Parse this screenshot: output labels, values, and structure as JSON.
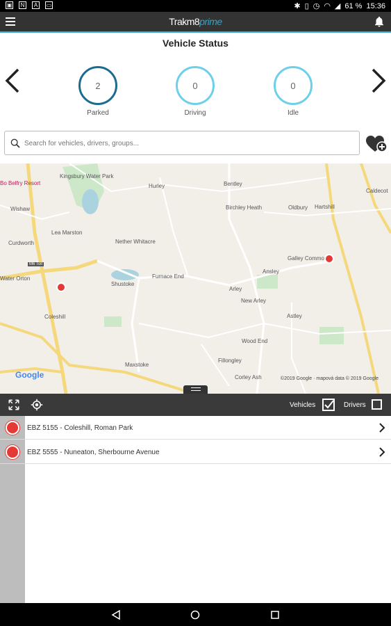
{
  "statusbar": {
    "left_icons": [
      "image-icon",
      "n-icon",
      "a-icon",
      "screen-icon"
    ],
    "right_icons": [
      "bluetooth-icon",
      "vibrate-icon",
      "alarm-icon",
      "wifi-icon",
      "signal-icon"
    ],
    "battery": "61 %",
    "time": "15:36"
  },
  "appbar": {
    "logo_main": "Trakm8",
    "logo_accent": "prime"
  },
  "vehicle_status": {
    "title": "Vehicle Status",
    "parked": {
      "count": "2",
      "label": "Parked"
    },
    "driving": {
      "count": "0",
      "label": "Driving"
    },
    "idle": {
      "count": "0",
      "label": "Idle"
    }
  },
  "search": {
    "placeholder": "Search for vehicles, drivers, groups..."
  },
  "map": {
    "labels": [
      "Kingsbury Water Park",
      "Hurley",
      "Bentley",
      "Caldecot",
      "Bo Belfry Resort",
      "Wishaw",
      "Birchley Heath",
      "Oldbury",
      "Hartshill",
      "Lea Marston",
      "Curdworth",
      "Nether Whitacre",
      "Galley Common",
      "Ansley",
      "M6 Toll",
      "Water Orton",
      "Shustoke",
      "Furnace End",
      "Arley",
      "New Arley",
      "Coleshill",
      "Astley",
      "Wood End",
      "Fillongley",
      "Maxstoke",
      "Corley Ash"
    ],
    "logo": "Google",
    "copyright": "©2019 Google · mapová data © 2019 Google"
  },
  "toolbar": {
    "vehicles_label": "Vehicles",
    "drivers_label": "Drivers",
    "vehicles_checked": true,
    "drivers_checked": false
  },
  "vehicles": [
    {
      "text": "EBZ 5155 - Coleshill, Roman Park"
    },
    {
      "text": "EBZ 5555 - Nuneaton, Sherbourne Avenue"
    }
  ],
  "colors": {
    "accent": "#2fa6c9",
    "appbar": "#333333",
    "parked_ring": "#1b6c8e",
    "pin": "#e53935"
  }
}
